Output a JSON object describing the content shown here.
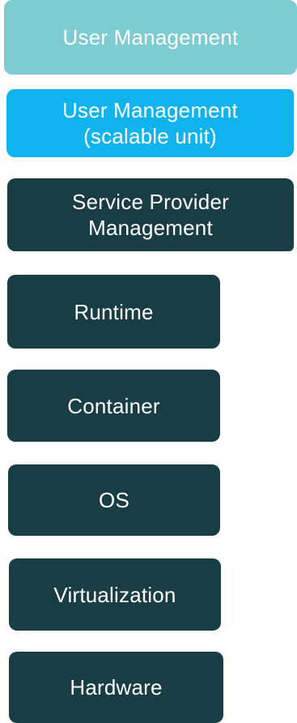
{
  "colors": {
    "light_teal": "#7cccd1",
    "cyan": "#10b3ee",
    "dark_teal": "#183d45",
    "text": "#ffffff"
  },
  "layers": [
    {
      "lines": [
        "User Management"
      ],
      "color": "light_teal"
    },
    {
      "lines": [
        "User Management",
        "(scalable unit)"
      ],
      "color": "cyan"
    },
    {
      "lines": [
        "Service Provider",
        "Management"
      ],
      "color": "dark_teal"
    },
    {
      "lines": [
        "Runtime"
      ],
      "color": "dark_teal"
    },
    {
      "lines": [
        "Container"
      ],
      "color": "dark_teal"
    },
    {
      "lines": [
        "OS"
      ],
      "color": "dark_teal"
    },
    {
      "lines": [
        "Virtualization"
      ],
      "color": "dark_teal"
    },
    {
      "lines": [
        "Hardware"
      ],
      "color": "dark_teal"
    }
  ]
}
